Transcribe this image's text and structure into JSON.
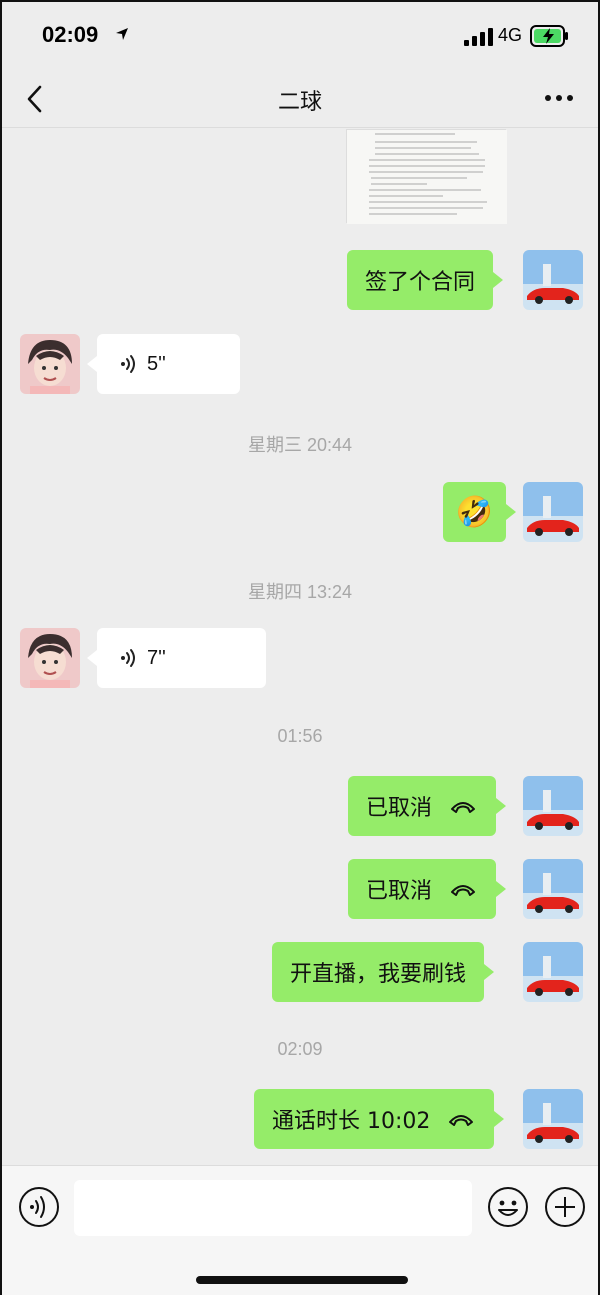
{
  "status_bar": {
    "time": "02:09",
    "network": "4G"
  },
  "header": {
    "title": "二球"
  },
  "messages": [
    {
      "kind": "text",
      "side": "self",
      "text": "签了个合同"
    },
    {
      "kind": "voice",
      "side": "other",
      "duration": "5''"
    },
    {
      "kind": "timestamp",
      "text": "星期三 20:44"
    },
    {
      "kind": "emoji",
      "side": "self",
      "emoji": "🤣"
    },
    {
      "kind": "timestamp",
      "text": "星期四 13:24"
    },
    {
      "kind": "voice",
      "side": "other",
      "duration": "7''"
    },
    {
      "kind": "timestamp",
      "text": "01:56"
    },
    {
      "kind": "call",
      "side": "self",
      "text": "已取消"
    },
    {
      "kind": "call",
      "side": "self",
      "text": "已取消"
    },
    {
      "kind": "text",
      "side": "self",
      "text": "开直播，我要刷钱"
    },
    {
      "kind": "timestamp",
      "text": "02:09"
    },
    {
      "kind": "call",
      "side": "self",
      "text": "通话时长 10:02"
    }
  ],
  "input": {
    "placeholder": ""
  },
  "colors": {
    "bubble_self": "#95ec69",
    "bubble_other": "#ffffff",
    "background": "#ededed"
  }
}
